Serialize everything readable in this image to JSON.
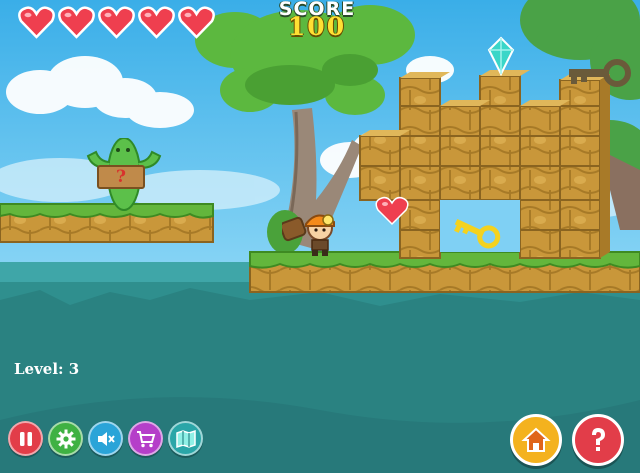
{
  "hud": {
    "score_label": "SCORE",
    "score_value": "100",
    "lives": 5,
    "level_text": "Level: 3"
  },
  "sign": {
    "text": "?"
  },
  "icons": {
    "heart": "heart-icon",
    "pause": "pause-icon",
    "settings": "gear-icon",
    "sound": "speaker-muted-icon",
    "shop": "cart-icon",
    "map": "map-icon",
    "home": "home-icon",
    "help": "question-icon",
    "key": "key-icon",
    "gem": "gem-icon"
  },
  "colors": {
    "sky": "#5ec3ef",
    "water": "#2f8f8e",
    "grass": "#63b63c",
    "dirt": "#c99a3c",
    "heart": "#ef3f4f",
    "score_value": "#ffe033"
  }
}
